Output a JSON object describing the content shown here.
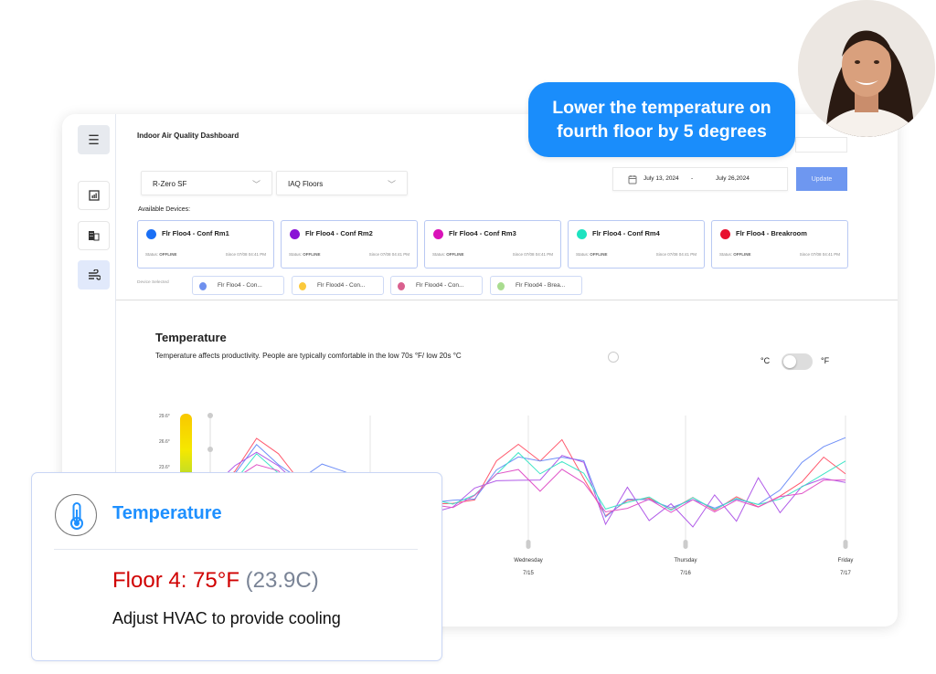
{
  "chat": {
    "message": "Lower the temperature on fourth floor by 5 degrees"
  },
  "dashboard": {
    "title": "Indoor Air Quality Dashboard",
    "location_select": "R-Zero SF",
    "group_select": "IAQ Floors",
    "date_start": "July 13, 2024",
    "date_sep": "-",
    "date_end": "July 26,2024",
    "update_label": "Update",
    "available_label": "Available Devices:",
    "devices": [
      {
        "name": "Flr Floo4 - Conf Rm1",
        "status_label": "Status:",
        "status": "OFFLINE",
        "since": "Since 07/08 04:41 PM",
        "color": "#1a6ff5"
      },
      {
        "name": "Flr Floo4 - Conf Rm2",
        "status_label": "Status:",
        "status": "OFFLINE",
        "since": "Since 07/08 04:41 PM",
        "color": "#8a12d6"
      },
      {
        "name": "Flr Floo4 - Conf Rm3",
        "status_label": "Status:",
        "status": "OFFLINE",
        "since": "Since 07/08 04:41 PM",
        "color": "#d912b8"
      },
      {
        "name": "Flr Floo4 - Conf Rm4",
        "status_label": "Status:",
        "status": "OFFLINE",
        "since": "Since 07/08 04:41 PM",
        "color": "#1de3c0"
      },
      {
        "name": "Flr Floo4 - Breakroom",
        "status_label": "Status:",
        "status": "OFFLINE",
        "since": "Since 07/08 04:41 PM",
        "color": "#e8102e"
      }
    ],
    "selected_label": "Device Selected",
    "selected": [
      {
        "name": "Flr Floo4 - Con...",
        "color": "#6f90ee"
      },
      {
        "name": "Flr Flood4 - Con...",
        "color": "#fbc93c"
      },
      {
        "name": "Flr Flood4 - Con...",
        "color": "#d9608e"
      },
      {
        "name": "Flr Flood4 - Brea...",
        "color": "#a9dc8f"
      }
    ],
    "section_title": "Temperature",
    "section_desc": "Temperature affects productivity. People are typically comfortable in the low 70s °F/ low 20s °C",
    "unit_c": "°C",
    "unit_f": "°F",
    "unit_toggle_on": false
  },
  "chart_data": {
    "type": "line",
    "y_ticks": [
      "29.6°",
      "26.6°",
      "23.6°"
    ],
    "ylim": [
      17,
      29.6
    ],
    "x_ticks": [
      {
        "day": "Wednesday",
        "date": "7/15"
      },
      {
        "day": "Thursday",
        "date": "7/16"
      },
      {
        "day": "Friday",
        "date": "7/17"
      }
    ],
    "series": [
      {
        "color": "#ff5a6e",
        "values": [
          21,
          23,
          27,
          25,
          22,
          22,
          22,
          21,
          21,
          20,
          19.5,
          19,
          20,
          24,
          26.5,
          24,
          27,
          22,
          18,
          19.5,
          20,
          18.5,
          20,
          18.5,
          20,
          19,
          20,
          22,
          24.5,
          23
        ]
      },
      {
        "color": "#6f8ff7",
        "values": [
          21,
          23,
          26,
          24,
          22,
          24,
          23,
          22,
          22,
          20,
          19.5,
          19.5,
          20,
          23,
          25,
          24,
          25,
          24,
          18,
          19.5,
          20,
          18.5,
          20,
          18.5,
          20,
          19,
          21,
          24,
          26,
          27
        ]
      },
      {
        "color": "#b05ae8",
        "values": [
          21,
          24,
          25,
          24,
          21,
          21,
          21,
          20,
          19,
          18,
          18,
          19,
          21,
          22,
          22,
          22,
          25,
          24,
          17,
          21,
          17.5,
          19,
          16.8,
          20,
          17.5,
          22,
          18.5,
          21,
          22.5,
          21.5
        ]
      },
      {
        "color": "#3fe5c6",
        "values": [
          21,
          22,
          25,
          23,
          21,
          21,
          21,
          21,
          21,
          20,
          19.5,
          19.5,
          20,
          23,
          25,
          23,
          24,
          23,
          18.5,
          19.5,
          20,
          18.5,
          20,
          18.5,
          20,
          19,
          20,
          21,
          23,
          24
        ]
      },
      {
        "color": "#e055c8",
        "values": [
          21,
          22,
          24,
          23,
          20,
          20,
          20,
          20,
          20,
          19.5,
          19,
          19,
          20,
          23,
          23,
          21,
          23,
          22,
          18,
          19,
          19.5,
          18.5,
          19.5,
          18.5,
          19.5,
          19,
          20,
          20.5,
          22,
          22
        ]
      }
    ]
  },
  "alert": {
    "title": "Temperature",
    "reading": "Floor 4: 75°F",
    "reading_c": "(23.9C)",
    "action": "Adjust HVAC to provide cooling"
  }
}
